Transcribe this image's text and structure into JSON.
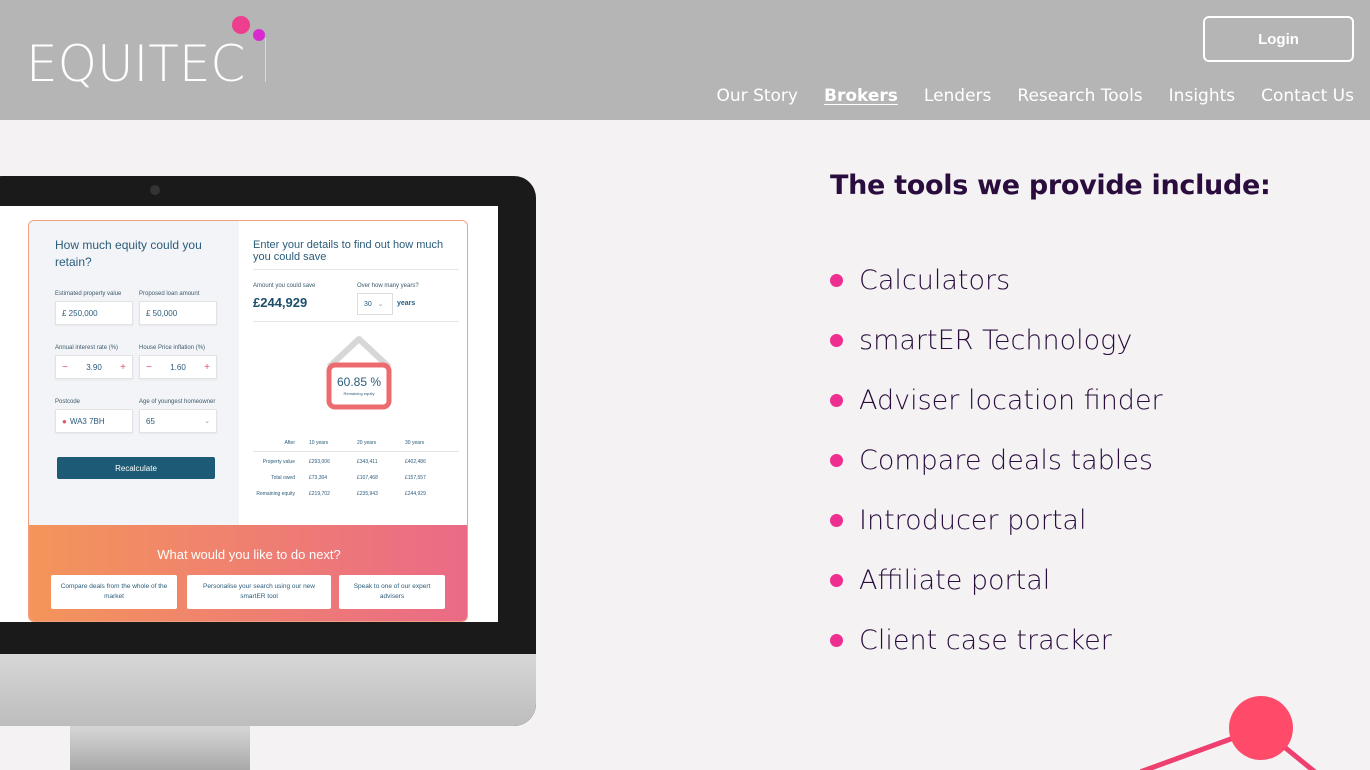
{
  "header": {
    "logo_text": "EQUITEC",
    "login_label": "Login",
    "nav": [
      {
        "label": "Our Story",
        "active": false
      },
      {
        "label": "Brokers",
        "active": true
      },
      {
        "label": "Lenders",
        "active": false
      },
      {
        "label": "Research Tools",
        "active": false
      },
      {
        "label": "Insights",
        "active": false
      },
      {
        "label": "Contact Us",
        "active": false
      }
    ]
  },
  "calculator": {
    "question": "How much equity could you retain?",
    "property_value_label": "Estimated property value",
    "property_value": "£  250,000",
    "loan_amount_label": "Proposed loan amount",
    "loan_amount": "£  50,000",
    "interest_label": "Annual interest rate (%)",
    "interest_value": "3.90",
    "inflation_label": "House Price inflation (%)",
    "inflation_value": "1.60",
    "postcode_label": "Postcode",
    "postcode_value": "WA3 7BH",
    "age_label": "Age of youngest homeowner",
    "age_value": "65",
    "recalc_label": "Recalculate",
    "right_title": "Enter your details to find out how much you could save",
    "save_label": "Amount you could save",
    "save_amount": "£244,929",
    "years_label": "Over how many years?",
    "years_value": "30",
    "years_word": "years",
    "equity_pct": "60.85 %",
    "equity_sub": "Remaining equity",
    "table": {
      "headers": [
        "After",
        "10 years",
        "20 years",
        "30 years"
      ],
      "rows": [
        [
          "Property value",
          "£293,006",
          "£343,411",
          "£402,486"
        ],
        [
          "Total owed",
          "£73,304",
          "£107,468",
          "£157,557"
        ],
        [
          "Remaining equity",
          "£219,702",
          "£235,943",
          "£244,929"
        ]
      ]
    },
    "next_question": "What would you like to do next?",
    "next_buttons": [
      "Compare deals from the whole of the market",
      "Personalise your search using our new smartER tool",
      "Speak to one of our expert advisers"
    ]
  },
  "tools": {
    "title": "The tools we provide include:",
    "items": [
      "Calculators",
      "smartER Technology",
      "Adviser location finder",
      "Compare deals tables",
      "Introducer portal",
      "Affiliate portal",
      "Client case tracker"
    ]
  },
  "colors": {
    "header_bg": "#b5b5b5",
    "accent_pink": "#ee2f8f",
    "heading": "#2a0d3e",
    "teal": "#1d5a75"
  }
}
